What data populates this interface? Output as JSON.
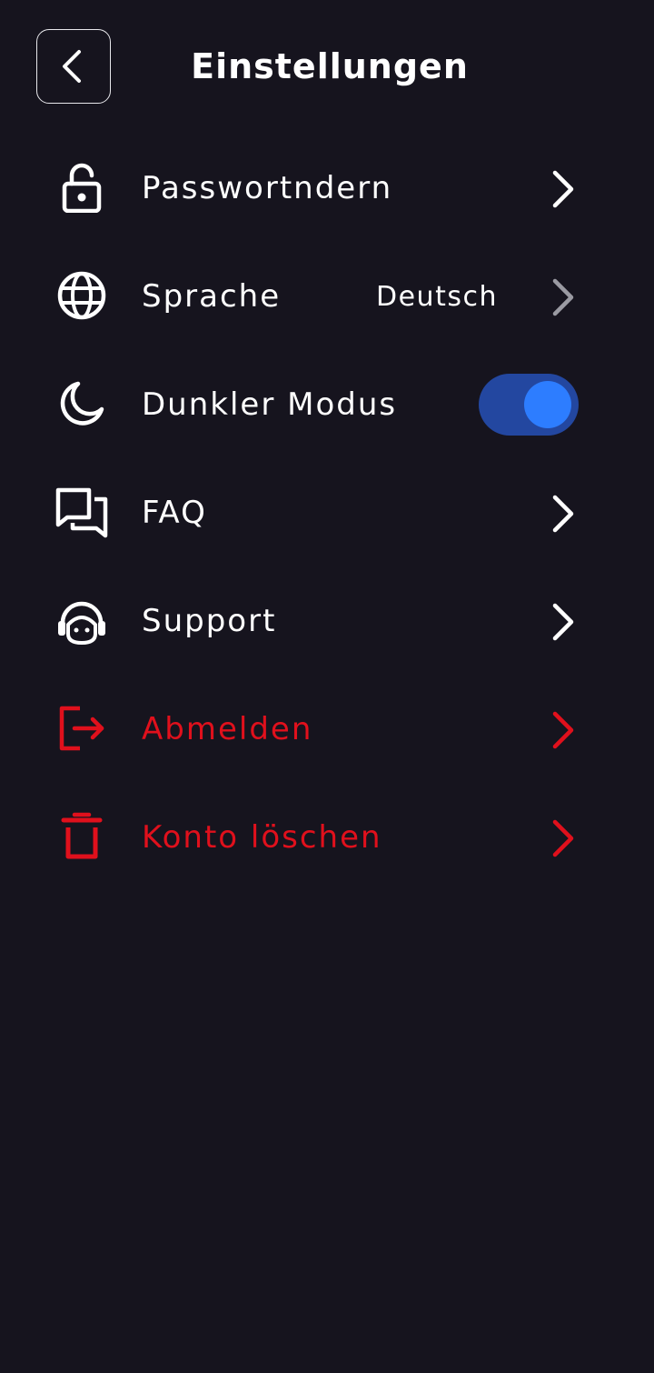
{
  "header": {
    "title": "Einstellungen",
    "back_icon": "chevron-left-icon"
  },
  "colors": {
    "background": "#16141e",
    "text": "#ffffff",
    "danger": "#e0101c",
    "toggle_track": "#2347a0",
    "toggle_knob": "#2d7dff",
    "chevron_muted": "#9a9aa2"
  },
  "settings": {
    "password": {
      "label": "Passwortndern",
      "icon": "lock-icon"
    },
    "language": {
      "label": "Sprache",
      "value": "Deutsch",
      "icon": "globe-icon"
    },
    "dark_mode": {
      "label": "Dunkler Modus",
      "icon": "moon-icon",
      "enabled": true
    },
    "faq": {
      "label": "FAQ",
      "icon": "chat-bubbles-icon"
    },
    "support": {
      "label": "Support",
      "icon": "headset-icon"
    },
    "logout": {
      "label": "Abmelden",
      "icon": "logout-icon"
    },
    "delete_account": {
      "label": "Konto löschen",
      "icon": "trash-icon"
    }
  }
}
